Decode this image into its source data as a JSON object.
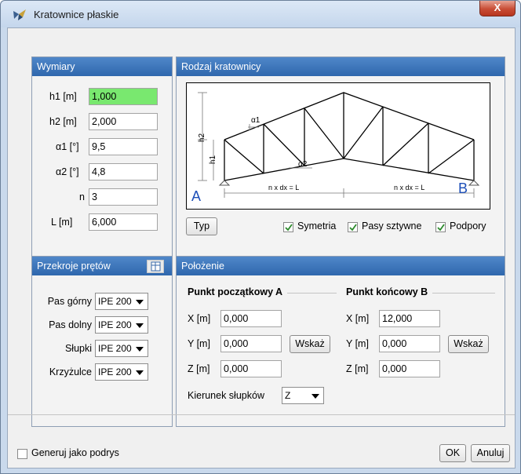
{
  "window": {
    "title": "Kratownice płaskie",
    "close_label": "X"
  },
  "dimensions": {
    "header": "Wymiary",
    "fields": [
      {
        "label": "h1 [m]",
        "value": "1,000"
      },
      {
        "label": "h2 [m]",
        "value": "2,000"
      },
      {
        "label": "α1 [°]",
        "value": "9,5"
      },
      {
        "label": "α2 [°]",
        "value": "4,8"
      },
      {
        "label": "n",
        "value": "3"
      },
      {
        "label": "L [m]",
        "value": "6,000"
      }
    ]
  },
  "truss_type": {
    "header": "Rodzaj kratownicy",
    "diagram": {
      "label_A": "A",
      "label_B": "B",
      "h1": "h1",
      "h2": "h2",
      "alpha1": "α1",
      "alpha2": "α2",
      "dim_left": "n x dx = L",
      "dim_right": "n x dx = L"
    },
    "type_button": "Typ",
    "checkboxes": [
      {
        "label": "Symetria",
        "checked": true
      },
      {
        "label": "Pasy sztywne",
        "checked": true
      },
      {
        "label": "Podpory",
        "checked": true
      }
    ]
  },
  "sections": {
    "header": "Przekroje prętów",
    "rows": [
      {
        "label": "Pas górny",
        "value": "IPE 200"
      },
      {
        "label": "Pas dolny",
        "value": "IPE 200"
      },
      {
        "label": "Słupki",
        "value": "IPE 200"
      },
      {
        "label": "Krzyżulce",
        "value": "IPE 200"
      }
    ]
  },
  "position": {
    "header": "Położenie",
    "start": {
      "title": "Punkt początkowy A",
      "x_label": "X [m]",
      "x": "0,000",
      "y_label": "Y [m]",
      "y": "0,000",
      "z_label": "Z [m]",
      "z": "0,000",
      "pick": "Wskaż"
    },
    "end": {
      "title": "Punkt końcowy B",
      "x_label": "X [m]",
      "x": "12,000",
      "y_label": "Y [m]",
      "y": "0,000",
      "z_label": "Z [m]",
      "z": "0,000",
      "pick": "Wskaż"
    },
    "direction_label": "Kierunek słupków",
    "direction_value": "Z"
  },
  "footer": {
    "generate_label": "Generuj jako podrys",
    "generate_checked": false,
    "ok": "OK",
    "cancel": "Anuluj"
  }
}
